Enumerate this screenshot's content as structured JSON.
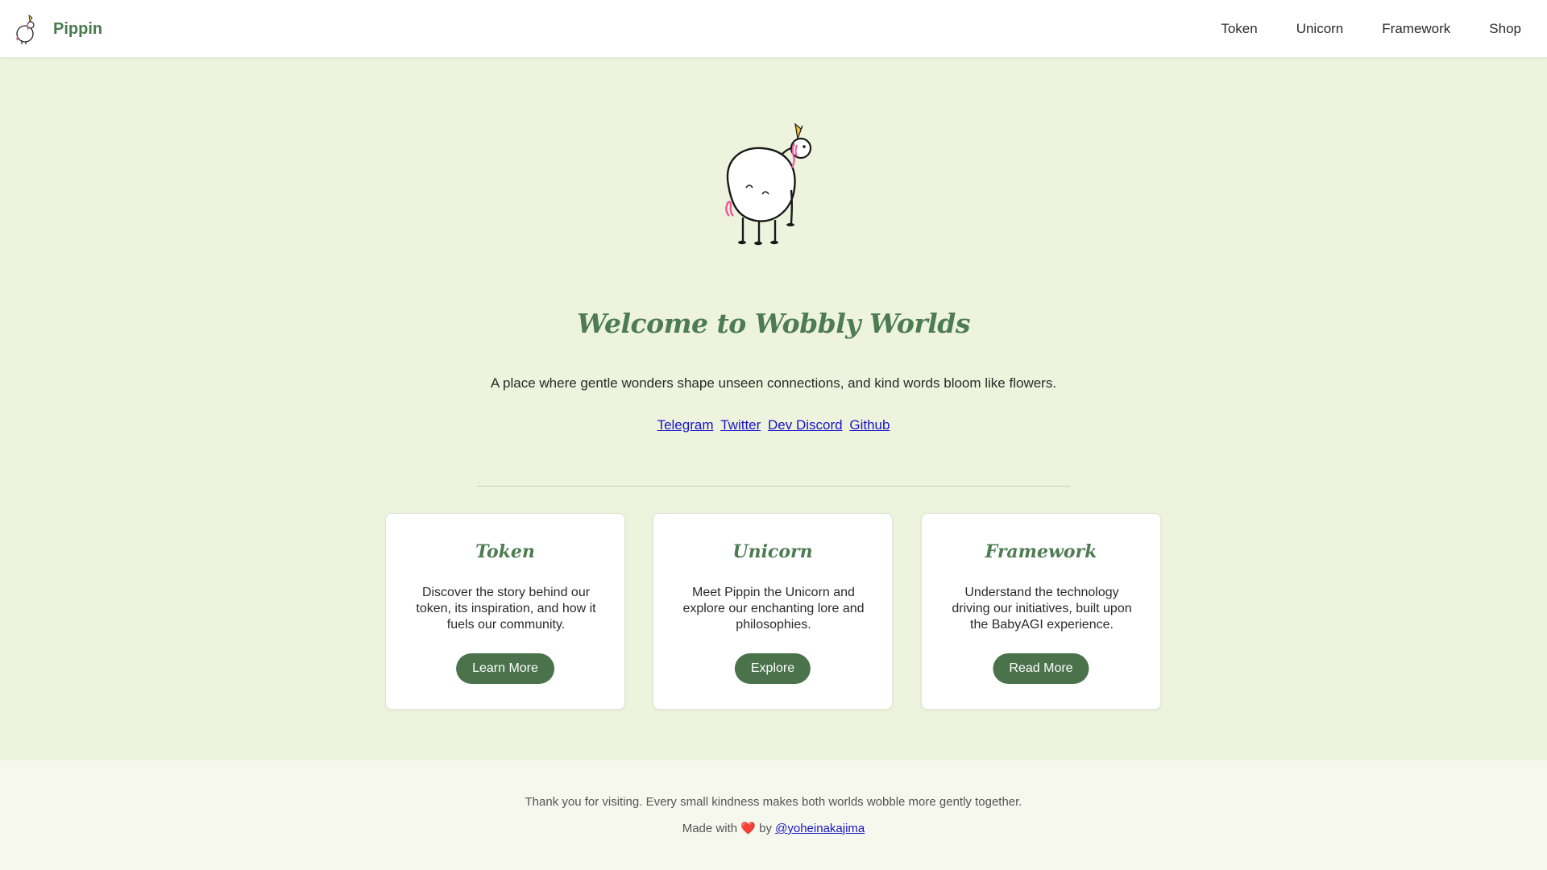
{
  "nav": {
    "brand": "Pippin",
    "logo_icon": "unicorn-icon",
    "links": [
      "Token",
      "Unicorn",
      "Framework",
      "Shop"
    ]
  },
  "hero": {
    "image_icon": "pippin-unicorn-illustration",
    "title": "Welcome to Wobbly Worlds",
    "subtitle": "A place where gentle wonders shape unseen connections, and kind words bloom like flowers.",
    "social_links": [
      "Telegram",
      "Twitter",
      "Dev Discord",
      "Github"
    ]
  },
  "cards": [
    {
      "title": "Token",
      "description": "Discover the story behind our token, its inspiration, and how it fuels our community.",
      "button": "Learn More"
    },
    {
      "title": "Unicorn",
      "description": "Meet Pippin the Unicorn and explore our enchanting lore and philosophies.",
      "button": "Explore"
    },
    {
      "title": "Framework",
      "description": "Understand the technology driving our initiatives, built upon the BabyAGI experience.",
      "button": "Read More"
    }
  ],
  "footer": {
    "thanks": "Thank you for visiting. Every small kindness makes both worlds wobble more gently together.",
    "made_with": "Made with",
    "heart": "❤️",
    "by": "by",
    "author": "@yoheinakajima"
  },
  "colors": {
    "accent": "#4d7c52",
    "button": "#4a734c",
    "link": "#1a14c8",
    "page_bg": "#eef3dd"
  }
}
